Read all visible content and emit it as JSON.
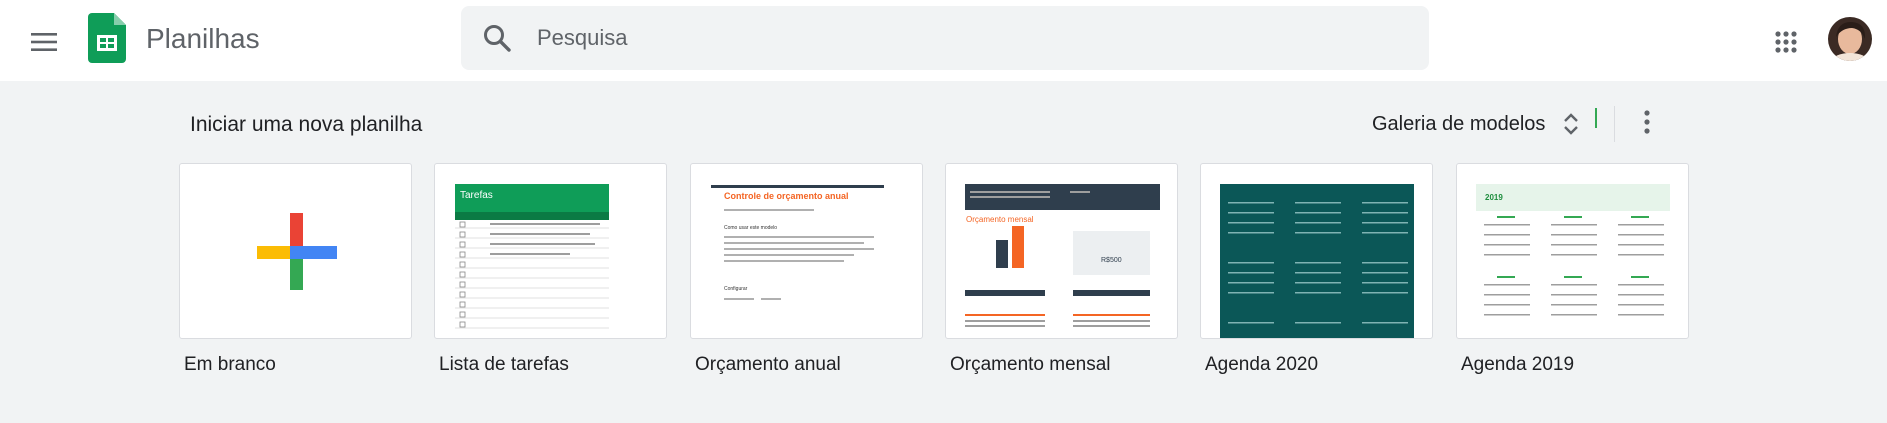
{
  "header": {
    "app_title": "Planilhas",
    "menu_icon": "hamburger-menu-icon",
    "logo_icon": "sheets-logo-icon",
    "apps_icon": "google-apps-grid-icon",
    "search": {
      "placeholder": "Pesquisa",
      "value": ""
    }
  },
  "templates": {
    "section_title": "Iniciar uma nova planilha",
    "gallery_label": "Galeria de modelos",
    "items": [
      {
        "label": "Em branco"
      },
      {
        "label": "Lista de tarefas",
        "preview_title": "Tarefas"
      },
      {
        "label": "Orçamento anual",
        "preview_title": "Controle de orçamento anual",
        "preview_subtitle": "Como usar este modelo",
        "preview_section": "Configurar"
      },
      {
        "label": "Orçamento mensal",
        "preview_title": "Orçamento mensal",
        "preview_value": "R$500"
      },
      {
        "label": "Agenda 2020"
      },
      {
        "label": "Agenda 2019",
        "preview_year": "2019"
      }
    ]
  },
  "colors": {
    "sheets_green": "#0f9d58",
    "plus_red": "#ea4335",
    "plus_blue": "#4285f4",
    "plus_yellow": "#fbbc04",
    "plus_green": "#34a853",
    "teal": "#0b5757",
    "orange": "#f46524"
  }
}
